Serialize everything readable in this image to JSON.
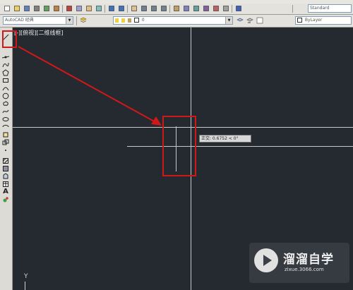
{
  "menubar": {
    "visible": true
  },
  "toolbar_top": {
    "icons": [
      "new-icon",
      "open-icon",
      "save-icon",
      "print-icon",
      "preview-icon",
      "publish-icon",
      "cut-icon",
      "copy-icon",
      "paste-icon",
      "match-icon",
      "undo-icon",
      "redo-icon",
      "pan-icon",
      "zoom-realtime-icon",
      "zoom-window-icon",
      "zoom-previous-icon",
      "properties-icon",
      "designcenter-icon",
      "toolpalettes-icon",
      "sheetset-icon",
      "markup-icon",
      "calculator-icon",
      "help-icon",
      "text-style-icon"
    ],
    "text_style": "Standard"
  },
  "toolbar_second": {
    "workspace": "AutoCAD 经典",
    "layer": "0",
    "linetype": "ByLayer"
  },
  "draw_toolbar": {
    "icons": [
      "line-icon",
      "construction-line-icon",
      "polyline-icon",
      "polygon-icon",
      "rectangle-icon",
      "arc-icon",
      "circle-icon",
      "revision-cloud-icon",
      "spline-icon",
      "ellipse-icon",
      "ellipse-arc-icon",
      "insert-block-icon",
      "make-block-icon",
      "point-icon",
      "hatch-icon",
      "gradient-icon",
      "region-icon",
      "table-icon",
      "multiline-text-icon",
      "add-selected-icon"
    ],
    "text_glyph": "A"
  },
  "viewport": {
    "label": "[-][俯视][二维线框]",
    "tooltip": "正交: 0.6752 < 0°",
    "ucs_label": "Y"
  },
  "watermark": {
    "title": "溜溜自学",
    "url": "zixue.3066.com"
  },
  "colors": {
    "canvas": "#252a31",
    "highlight": "#d01818",
    "crosshair": "#c8c8c8"
  }
}
